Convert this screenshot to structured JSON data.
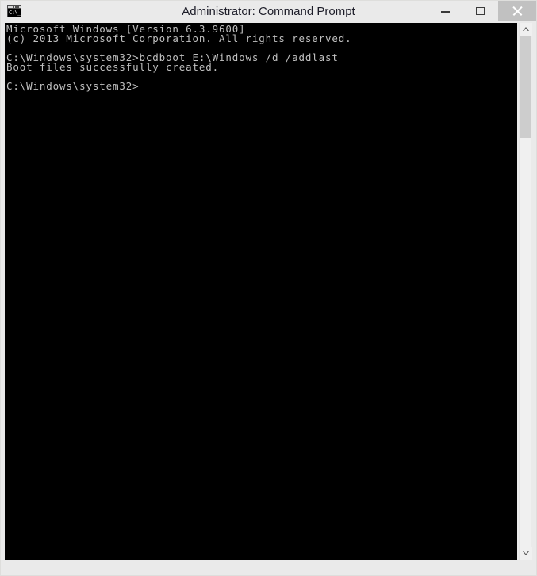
{
  "window": {
    "title": "Administrator: Command Prompt",
    "icon_name": "command-prompt-icon",
    "icon_text": "C:\\_",
    "background_color": "#eaeaea",
    "title_color": "#1d1d29"
  },
  "caption_buttons": {
    "minimize": {
      "label": "Minimize",
      "icon": "minimize-icon"
    },
    "maximize": {
      "label": "Maximize",
      "icon": "maximize-icon"
    },
    "close": {
      "label": "Close",
      "icon": "close-icon",
      "highlight_color": "#c1c1c1"
    }
  },
  "console": {
    "background_color": "#000000",
    "text_color": "#c0c0c0",
    "lines": [
      "Microsoft Windows [Version 6.3.9600]",
      "(c) 2013 Microsoft Corporation. All rights reserved.",
      "",
      "C:\\Windows\\system32>bcdboot E:\\Windows /d /addlast",
      "Boot files successfully created.",
      "",
      "C:\\Windows\\system32>"
    ],
    "text": "Microsoft Windows [Version 6.3.9600]\n(c) 2013 Microsoft Corporation. All rights reserved.\n\nC:\\Windows\\system32>bcdboot E:\\Windows /d /addlast\nBoot files successfully created.\n\nC:\\Windows\\system32>"
  },
  "scrollbar": {
    "up_arrow": "chevron-up-icon",
    "down_arrow": "chevron-down-icon",
    "thumb_color": "#cdcdcd",
    "track_color": "#f0f0f0"
  }
}
